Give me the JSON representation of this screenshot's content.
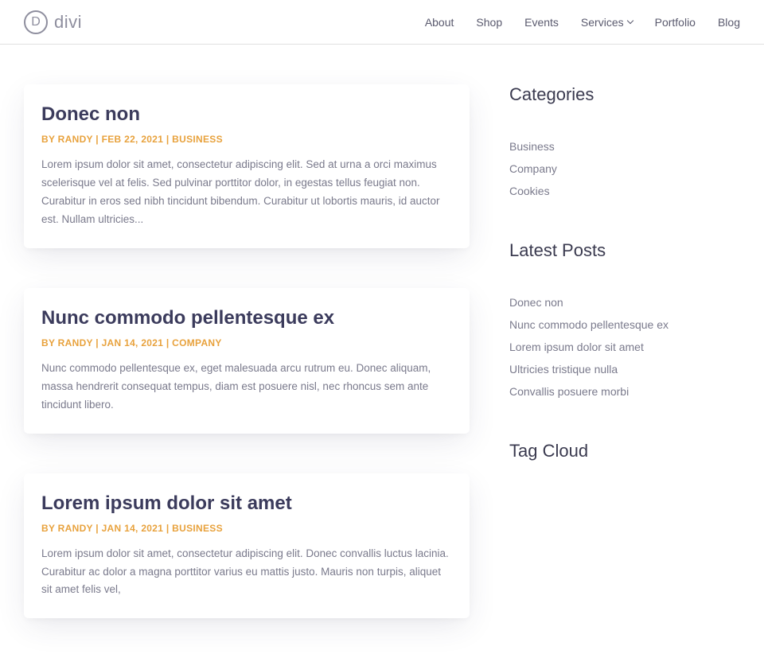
{
  "logo": {
    "letter": "D",
    "text": "divi"
  },
  "nav": {
    "about": "About",
    "shop": "Shop",
    "events": "Events",
    "services": "Services",
    "portfolio": "Portfolio",
    "blog": "Blog"
  },
  "posts": [
    {
      "title": "Donec non",
      "meta": "BY RANDY | FEB 22, 2021 | BUSINESS",
      "excerpt": "Lorem ipsum dolor sit amet, consectetur adipiscing elit. Sed at urna a orci maximus scelerisque vel at felis. Sed pulvinar porttitor dolor, in egestas tellus feugiat non. Curabitur in eros sed nibh tincidunt bibendum. Curabitur ut lobortis mauris, id auctor est. Nullam ultricies..."
    },
    {
      "title": "Nunc commodo pellentesque ex",
      "meta": "BY RANDY | JAN 14, 2021 | COMPANY",
      "excerpt": "Nunc commodo pellentesque ex, eget malesuada arcu rutrum eu. Donec aliquam, massa hendrerit consequat tempus, diam est posuere nisl, nec rhoncus sem ante tincidunt libero."
    },
    {
      "title": "Lorem ipsum dolor sit amet",
      "meta": "BY RANDY | JAN 14, 2021 | BUSINESS",
      "excerpt": "Lorem ipsum dolor sit amet, consectetur adipiscing elit. Donec convallis luctus lacinia. Curabitur ac dolor a magna porttitor varius eu mattis justo. Mauris non turpis, aliquet sit amet felis vel,"
    }
  ],
  "sidebar": {
    "categories": {
      "title": "Categories",
      "items": [
        "Business",
        "Company",
        "Cookies"
      ]
    },
    "latestPosts": {
      "title": "Latest Posts",
      "items": [
        "Donec non",
        "Nunc commodo pellentesque ex",
        "Lorem ipsum dolor sit amet",
        "Ultricies tristique nulla",
        "Convallis posuere morbi"
      ]
    },
    "tagCloud": {
      "title": "Tag Cloud"
    }
  }
}
